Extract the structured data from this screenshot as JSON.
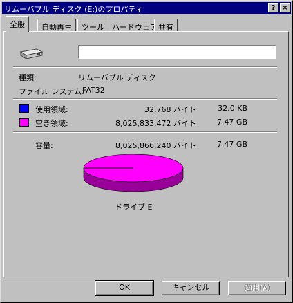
{
  "window": {
    "title": "リムーバブル ディスク (E:)のプロパティ",
    "help_glyph": "?",
    "close_glyph": "×"
  },
  "tabs": [
    {
      "label": "全般",
      "active": true
    },
    {
      "label": "自動再生",
      "active": false
    },
    {
      "label": "ツール",
      "active": false
    },
    {
      "label": "ハードウェア",
      "active": false
    },
    {
      "label": "共有",
      "active": false
    }
  ],
  "general": {
    "drive_icon": "removable-drive-icon",
    "name_value": "",
    "type_label": "種類:",
    "type_value": "リムーバブル ディスク",
    "fs_label": "ファイル システム:",
    "fs_value": "FAT32",
    "used": {
      "label": "使用領域:",
      "bytes": "32,768 バイト",
      "size": "32.0 KB",
      "color": "#0000ff"
    },
    "free": {
      "label": "空き領域:",
      "bytes": "8,025,833,472 バイト",
      "size": "7.47 GB",
      "color": "#ff00ff"
    },
    "capacity": {
      "label": "容量:",
      "bytes": "8,025,866,240 バイト",
      "size": "7.47 GB"
    },
    "drive_label": "ドライブ E"
  },
  "chart_data": {
    "type": "pie",
    "categories": [
      "使用領域",
      "空き領域"
    ],
    "values": [
      32768,
      8025833472
    ],
    "colors": [
      "#0000ff",
      "#ff00ff"
    ]
  },
  "buttons": {
    "ok": "OK",
    "cancel": "キャンセル",
    "apply": "適用(A)"
  }
}
